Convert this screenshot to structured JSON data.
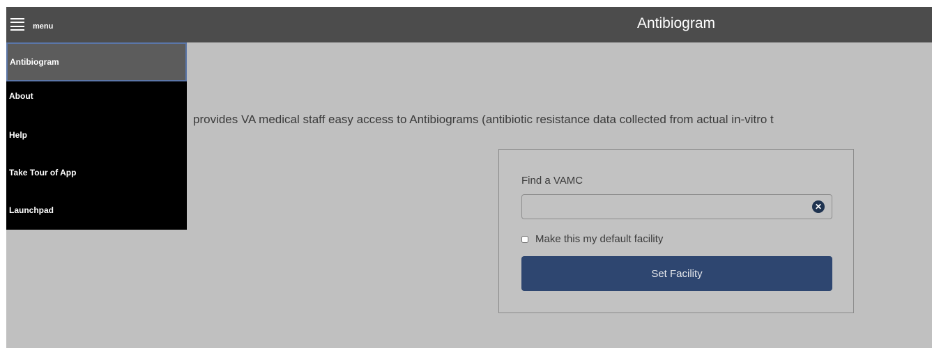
{
  "header": {
    "menu_label": "menu",
    "title": "Antibiogram",
    "menu_icon": "hamburger-icon"
  },
  "side_menu": {
    "items": [
      {
        "label": "Antibiogram",
        "active": true
      },
      {
        "label": "About"
      },
      {
        "label": "Help"
      },
      {
        "label": "Take Tour of App"
      },
      {
        "label": "Launchpad"
      }
    ]
  },
  "main": {
    "intro_text": "provides VA medical staff easy access to Antibiograms (antibiotic resistance data collected from actual in-vitro t"
  },
  "facility": {
    "find_label": "Find a VAMC",
    "search_value": "",
    "search_placeholder": "",
    "clear_icon": "clear-circle-x-icon",
    "default_label": "Make this my default facility",
    "default_checked": false,
    "set_button_label": "Set Facility"
  },
  "colors": {
    "topbar": "#4c4c4c",
    "sidebar": "#000000",
    "active_item": "#5c5c5c",
    "active_border": "#5b76a8",
    "button": "#2e4670",
    "background": "#c0c0c0"
  }
}
